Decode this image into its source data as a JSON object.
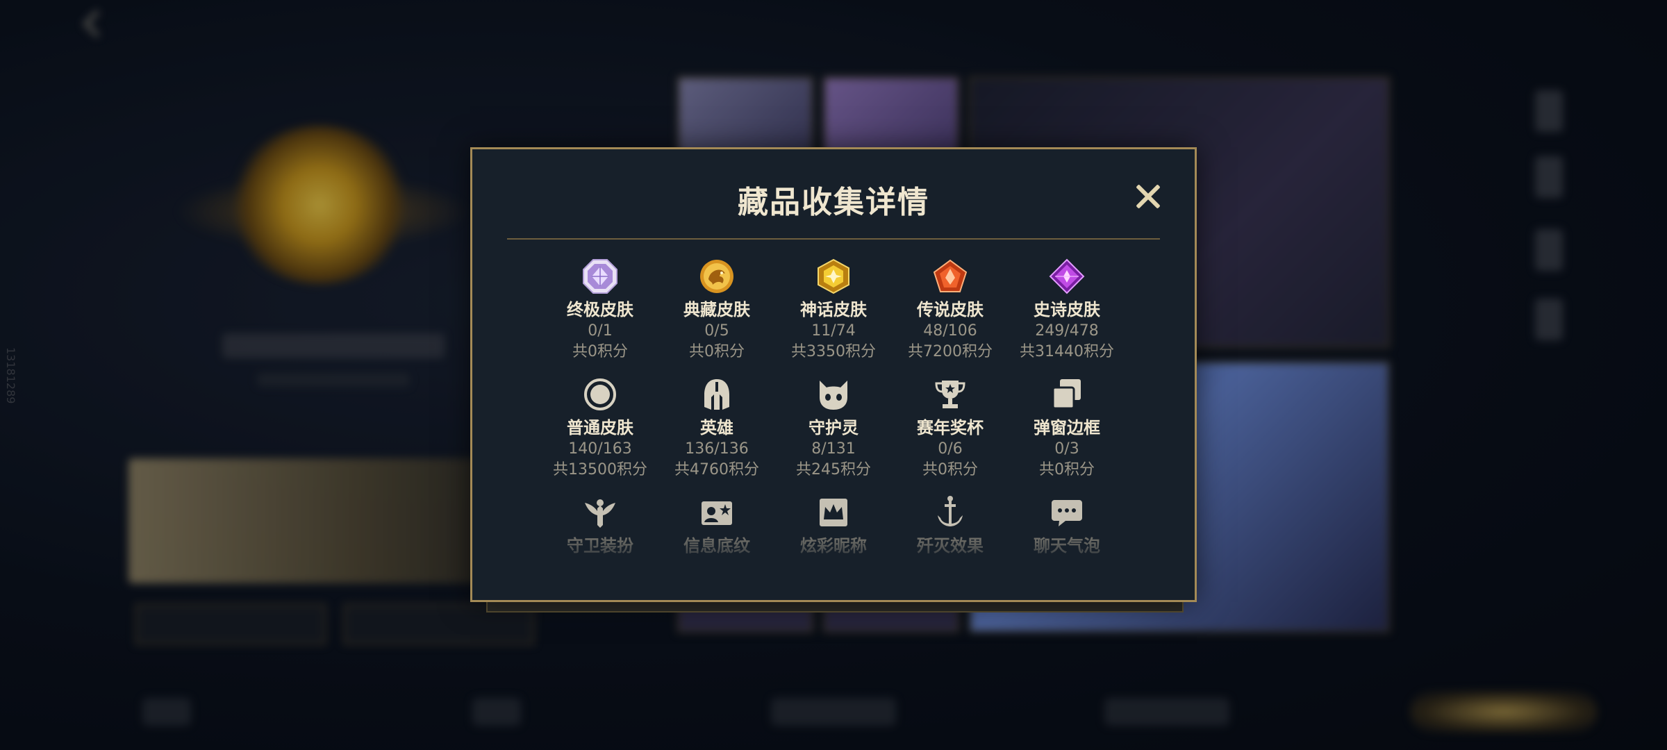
{
  "background": {
    "back_label": "",
    "vertical_id": "13181289"
  },
  "modal": {
    "title": "藏品收集详情",
    "categories": [
      {
        "name": "终极皮肤",
        "count": "0/1",
        "points": "共0积分",
        "icon": "octagon-gem-icon",
        "color": "#c9a9f0"
      },
      {
        "name": "典藏皮肤",
        "count": "0/5",
        "points": "共0积分",
        "icon": "dragon-coin-icon",
        "color": "#e0a72c"
      },
      {
        "name": "神话皮肤",
        "count": "11/74",
        "points": "共3350积分",
        "icon": "gold-hexagon-gem-icon",
        "color": "#f2c52a"
      },
      {
        "name": "传说皮肤",
        "count": "48/106",
        "points": "共7200积分",
        "icon": "orange-pentagon-gem-icon",
        "color": "#e8542b"
      },
      {
        "name": "史诗皮肤",
        "count": "249/478",
        "points": "共31440积分",
        "icon": "purple-diamond-gem-icon",
        "color": "#b43ad6"
      },
      {
        "name": "普通皮肤",
        "count": "140/163",
        "points": "共13500积分",
        "icon": "ring-icon",
        "color": "#d8d2c2"
      },
      {
        "name": "英雄",
        "count": "136/136",
        "points": "共4760积分",
        "icon": "helmet-icon",
        "color": "#d8d2c2"
      },
      {
        "name": "守护灵",
        "count": "8/131",
        "points": "共245积分",
        "icon": "spirit-face-icon",
        "color": "#d8d2c2"
      },
      {
        "name": "赛年奖杯",
        "count": "0/6",
        "points": "共0积分",
        "icon": "trophy-icon",
        "color": "#d8d2c2"
      },
      {
        "name": "弹窗边框",
        "count": "0/3",
        "points": "共0积分",
        "icon": "frame-stack-icon",
        "color": "#d8d2c2"
      },
      {
        "name": "守卫装扮",
        "icon": "guardian-wings-icon",
        "color": "#d8d2c2"
      },
      {
        "name": "信息底纹",
        "icon": "info-card-icon",
        "color": "#d8d2c2"
      },
      {
        "name": "炫彩昵称",
        "icon": "crown-card-icon",
        "color": "#d8d2c2"
      },
      {
        "name": "歼灭效果",
        "icon": "anchor-sword-icon",
        "color": "#d8d2c2"
      },
      {
        "name": "聊天气泡",
        "icon": "chat-bubble-icon",
        "color": "#d8d2c2"
      }
    ]
  }
}
